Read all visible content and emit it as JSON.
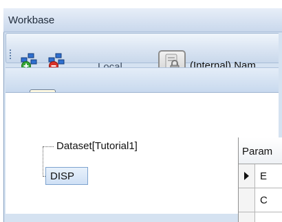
{
  "window": {
    "title": "Workbase"
  },
  "toolbar": {
    "connect_icon": "connect-server-icon",
    "disconnect_icon": "disconnect-server-icon",
    "location_label": "Local",
    "server_icon": "server-lock-icon",
    "server_name": "(Internal) Nam",
    "import_icon": "import-data-icon",
    "overflow_icon": "toolbar-overflow-icon"
  },
  "tree": {
    "root_label": "Dataset[Tutorial1]",
    "child_label": "DISP"
  },
  "grid": {
    "header": "Param",
    "rows": [
      {
        "value": "E",
        "current": true
      },
      {
        "value": "C",
        "current": false
      }
    ]
  },
  "colors": {
    "frame": "#d5e2f1",
    "selection": "#cfe0f5"
  }
}
